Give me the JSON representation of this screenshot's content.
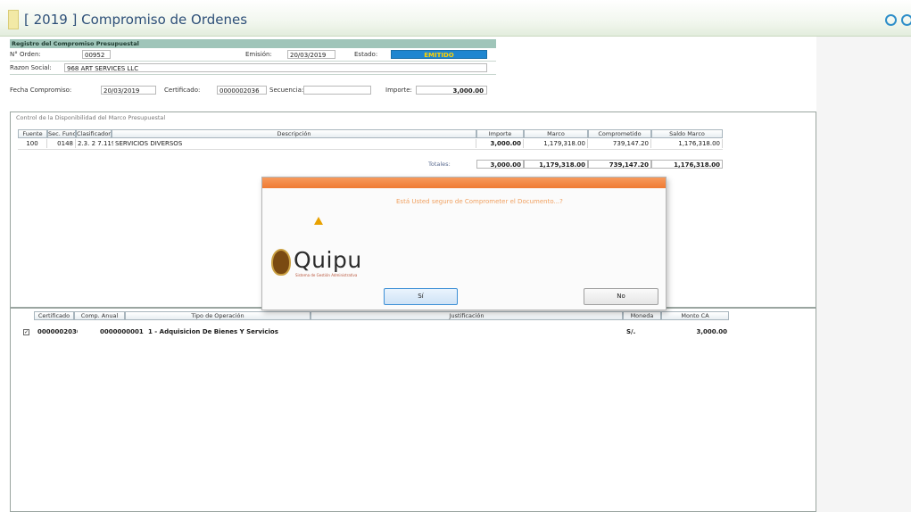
{
  "window": {
    "title": "[ 2019 ] Compromiso de Ordenes"
  },
  "registro": {
    "section_title": "Registro del Compromiso Presupuestal",
    "orden_label": "N° Orden:",
    "orden_value": "00952",
    "emision_label": "Emisión:",
    "emision_value": "20/03/2019",
    "estado_label": "Estado:",
    "estado_value": "EMITIDO",
    "razon_label": "Razon Social:",
    "razon_value": "968 ART SERVICES LLC",
    "fecha_label": "Fecha Compromiso:",
    "fecha_value": "20/03/2019",
    "certificado_label": "Certificado:",
    "certificado_value": "0000002036",
    "secuencia_label": "Secuencia:",
    "secuencia_value": "",
    "importe_label": "Importe:",
    "importe_value": "3,000.00"
  },
  "control_grid": {
    "title": "Control de la Disponibilidad del Marco Presupuestal",
    "headers": [
      "Fuente",
      "Sec. Func.",
      "Clasificador",
      "Descripción",
      "Importe",
      "Marco",
      "Comprometido",
      "Saldo Marco"
    ],
    "rows": [
      {
        "fuente": "100",
        "sec_func": "0148",
        "clasificador": "2.3. 2 7.1199",
        "descripcion": "SERVICIOS DIVERSOS",
        "importe": "3,000.00",
        "marco": "1,179,318.00",
        "comprometido": "739,147.20",
        "saldo": "1,176,318.00"
      }
    ],
    "totales_label": "Totales:",
    "totales": {
      "importe": "3,000.00",
      "marco": "1,179,318.00",
      "comprometido": "739,147.20",
      "saldo": "1,176,318.00"
    }
  },
  "dialog": {
    "message": "Está Usted seguro de Comprometer el Documento...?",
    "logo_text": "Quipu",
    "logo_sub": "Sistema de Gestión Administrativa",
    "yes_label": "Sí",
    "no_label": "No"
  },
  "cert_grid": {
    "headers": [
      "Certificado",
      "Comp. Anual",
      "Tipo de Operación",
      "Justificación",
      "Moneda",
      "Monto CA"
    ],
    "rows": [
      {
        "checked": "✓",
        "certificado": "0000002036",
        "comp_anual": "0000000001",
        "tipo": "1 - Adquisicion De Bienes Y Servicios",
        "justificacion": "",
        "moneda": "S/.",
        "monto": "3,000.00"
      }
    ]
  },
  "colors": {
    "estado_bg": "#1f86d0",
    "dialog_bar": "#ef7a33",
    "section_header": "#9fc5b9"
  }
}
